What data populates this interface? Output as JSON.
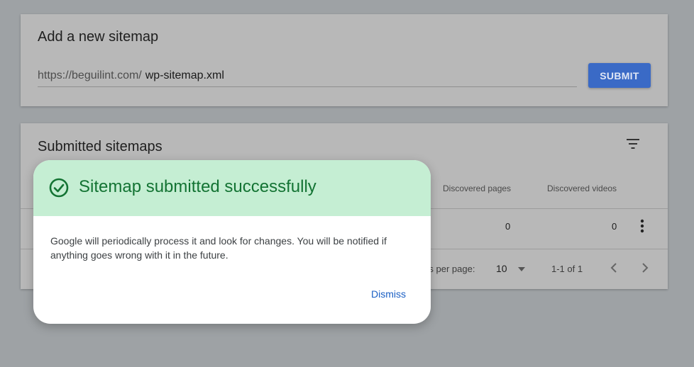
{
  "add_sitemap": {
    "title": "Add a new sitemap",
    "url_prefix": "https://beguilint.com/",
    "input_value": "wp-sitemap.xml",
    "submit_label": "SUBMIT"
  },
  "submitted_sitemaps": {
    "title": "Submitted sitemaps",
    "columns": [
      "Discovered pages",
      "Discovered videos"
    ],
    "rows": [
      {
        "discovered_pages": "0",
        "discovered_videos": "0"
      }
    ],
    "pagination": {
      "rows_per_page_label": "ws per page:",
      "rows_per_page_value": "10",
      "range": "1-1 of 1"
    }
  },
  "dialog": {
    "title": "Sitemap submitted successfully",
    "body": "Google will periodically process it and look for changes. You will be notified if anything goes wrong with it in the future.",
    "dismiss_label": "Dismiss"
  },
  "colors": {
    "submit_button": "#3a6ac6",
    "dialog_header": "#c5eed3",
    "success_green": "#137333",
    "link_blue": "#1a5fc4"
  },
  "icons": [
    "filter-icon",
    "more-vert-icon",
    "dropdown-caret-icon",
    "chevron-left-icon",
    "chevron-right-icon",
    "check-circle-icon"
  ]
}
